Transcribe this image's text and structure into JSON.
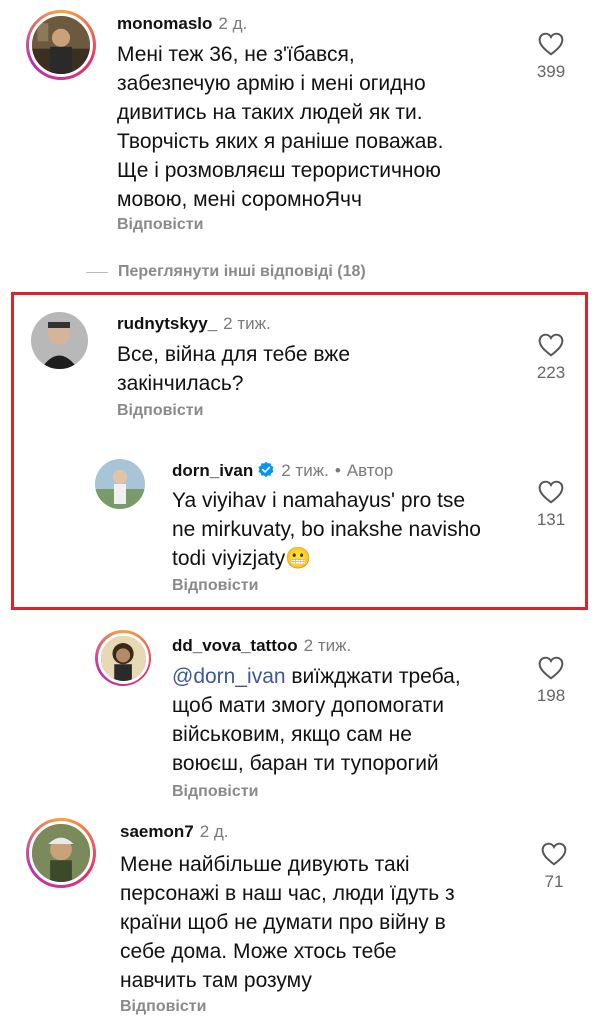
{
  "comments": [
    {
      "username": "monomaslo",
      "time": "2 д.",
      "text_lines": [
        "Мені теж 36, не з'їбався,",
        "забезпечую армію і мені огидно",
        "дивитись на таких людей як ти.",
        "Творчість яких я раніше поважав.",
        "Ще і розмовляєш терористичною",
        "мовою, мені соромноЯчч"
      ],
      "reply_label": "Відповісти",
      "likes": "399"
    },
    {
      "username": "rudnytskyy_",
      "time": "2 тиж.",
      "text_lines": [
        "Все, війна для тебе вже",
        "закінчилась?"
      ],
      "reply_label": "Відповісти",
      "likes": "223"
    },
    {
      "username": "dorn_ivan",
      "time": "2 тиж.",
      "author_label": "Автор",
      "separator": "•",
      "text_lines": [
        "Ya viyihav i namahayus' pro tse",
        "ne mirkuvaty, bo inakshe navisho",
        "todi viyizjaty😬"
      ],
      "reply_label": "Відповісти",
      "likes": "131"
    },
    {
      "username": "dd_vova_tattoo",
      "time": "2 тиж.",
      "mention": "@dorn_ivan",
      "text_first_rest": " виїжджати треба,",
      "text_lines": [
        "щоб мати змогу допомогати",
        "військовим, якщо сам не",
        "воюєш, баран ти тупорогий"
      ],
      "reply_label": "Відповісти",
      "likes": "198"
    },
    {
      "username": "saemon7",
      "time": "2 д.",
      "text_lines": [
        "Мене найбільше дивують такі",
        "персонажі в наш час, люди їдуть з",
        "країни щоб не думати про війну в",
        "себе дома. Може хтось тебе",
        "навчить там розуму"
      ],
      "reply_label": "Відповісти",
      "likes": "71"
    }
  ],
  "view_more_replies": "Переглянути інші відповіді (18)",
  "colors": {
    "highlight": "#d7262e",
    "verified": "#0095f6",
    "mention": "#3b5998",
    "muted": "#8a8a8a"
  },
  "icons": {
    "like": "heart-outline-icon",
    "verified": "verified-badge-icon"
  }
}
